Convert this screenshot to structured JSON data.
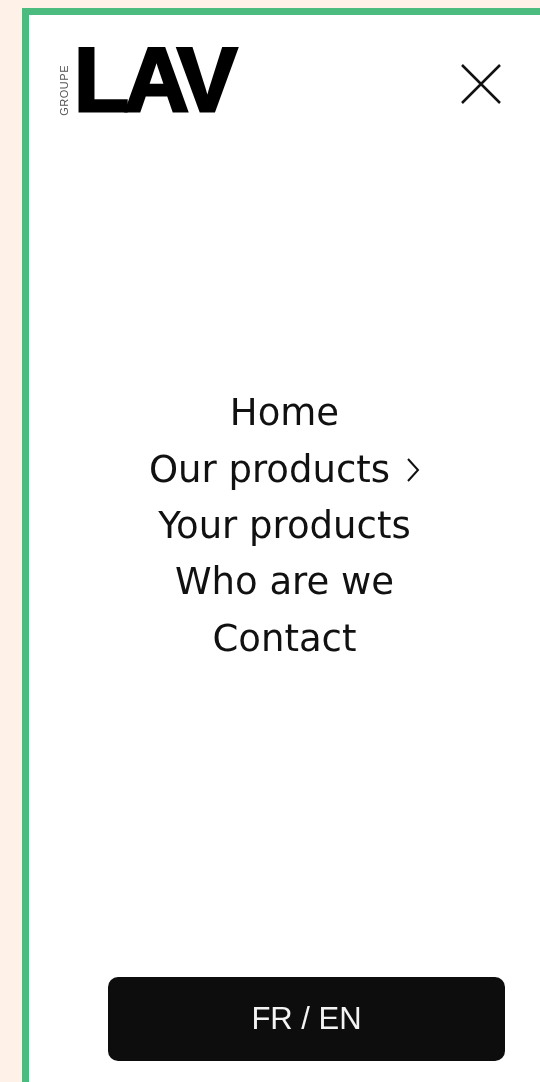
{
  "logo": {
    "prefix": "GROUPE",
    "name": "LAV"
  },
  "menu": [
    {
      "label": "Home",
      "has_submenu": false
    },
    {
      "label": "Our products",
      "has_submenu": true
    },
    {
      "label": "Your products",
      "has_submenu": false
    },
    {
      "label": "Who are we",
      "has_submenu": false
    },
    {
      "label": "Contact",
      "has_submenu": false
    }
  ],
  "language_button": "FR / EN"
}
